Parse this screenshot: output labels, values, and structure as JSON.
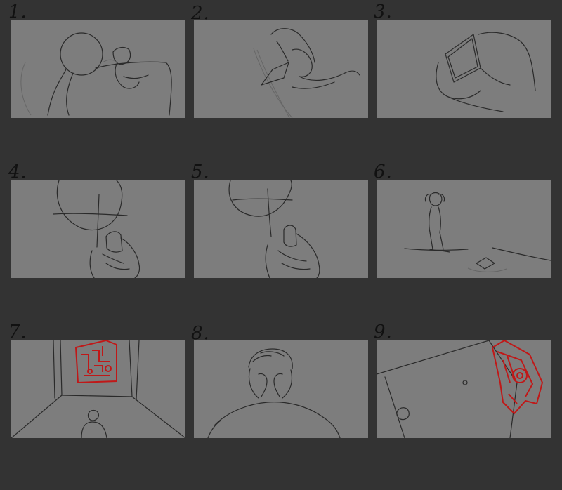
{
  "panels": [
    {
      "number": "1."
    },
    {
      "number": "2."
    },
    {
      "number": "3."
    },
    {
      "number": "4."
    },
    {
      "number": "5."
    },
    {
      "number": "6."
    },
    {
      "number": "7."
    },
    {
      "number": "8."
    },
    {
      "number": "9."
    }
  ],
  "colors": {
    "background": "#333333",
    "panel": "#7d7d7d",
    "sketch": "#2a2a2a",
    "accent_red": "#c01818"
  }
}
